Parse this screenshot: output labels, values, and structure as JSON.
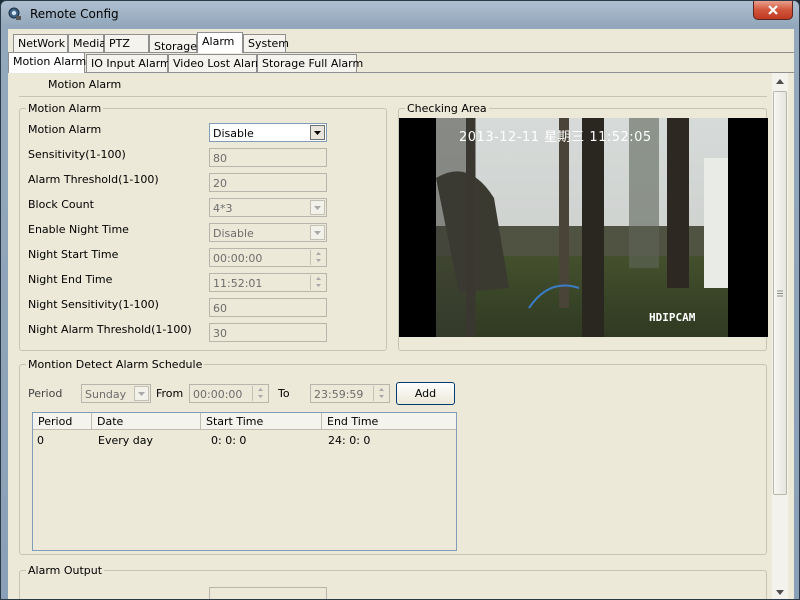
{
  "window": {
    "title": "Remote Config"
  },
  "main_tabs": [
    "NetWork",
    "Media",
    "PTZ",
    "Storage",
    "Alarm",
    "System"
  ],
  "sub_tabs": [
    "Motion Alarm",
    "IO Input Alarm",
    "Video Lost Alarm",
    "Storage Full Alarm"
  ],
  "page_heading": "Motion Alarm",
  "motion_group": {
    "title": "Motion Alarm",
    "motion_alarm": {
      "label": "Motion Alarm",
      "value": "Disable"
    },
    "sensitivity": {
      "label": "Sensitivity(1-100)",
      "value": "80"
    },
    "alarm_threshold": {
      "label": "Alarm Threshold(1-100)",
      "value": "20"
    },
    "block_count": {
      "label": "Block Count",
      "value": "4*3"
    },
    "enable_night": {
      "label": "Enable Night Time",
      "value": "Disable"
    },
    "night_start": {
      "label": "Night Start Time",
      "value": "00:00:00"
    },
    "night_end": {
      "label": "Night End Time",
      "value": "11:52:01"
    },
    "night_sensitivity": {
      "label": "Night Sensitivity(1-100)",
      "value": "60"
    },
    "night_threshold": {
      "label": "Night Alarm Threshold(1-100)",
      "value": "30"
    }
  },
  "checking_area": {
    "title": "Checking Area",
    "timestamp": "2013-12-11 星期三 11:52:05",
    "watermark": "HDIPCAM"
  },
  "schedule": {
    "title": "Montion Detect Alarm Schedule",
    "period_label": "Period",
    "period_value": "Sunday",
    "from_label": "From",
    "from_value": "00:00:00",
    "to_label": "To",
    "to_value": "23:59:59",
    "add_label": "Add",
    "columns": [
      "Period",
      "Date",
      "Start Time",
      "End Time"
    ],
    "rows": [
      [
        "0",
        "Every day",
        "0: 0: 0",
        "24: 0: 0"
      ]
    ]
  },
  "alarm_output": {
    "title": "Alarm Output"
  },
  "colors": {
    "close_button": "#c8452a",
    "selected_field_border": "#7f9db9",
    "button_border": "#003c74"
  }
}
